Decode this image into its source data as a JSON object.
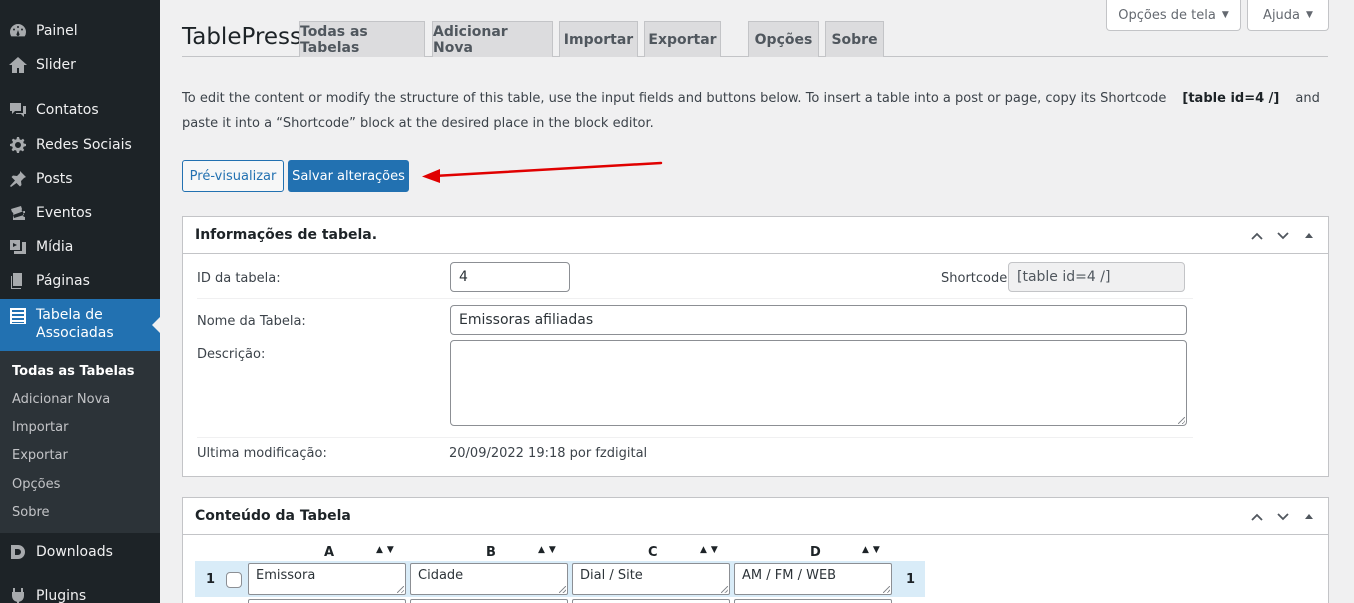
{
  "sidebar": {
    "items": [
      {
        "label": "Painel",
        "icon": "dashboard-icon"
      },
      {
        "label": "Slider",
        "icon": "home-icon"
      },
      {
        "label": "Contatos",
        "icon": "comments-icon"
      },
      {
        "label": "Redes Sociais",
        "icon": "gear-icon"
      },
      {
        "label": "Posts",
        "icon": "pin-icon"
      },
      {
        "label": "Eventos",
        "icon": "tickets-icon"
      },
      {
        "label": "Mídia",
        "icon": "media-icon"
      },
      {
        "label": "Páginas",
        "icon": "pages-icon"
      },
      {
        "label": "Tabela de Associadas",
        "icon": "list-icon"
      },
      {
        "label": "Downloads",
        "icon": "downloads-icon"
      },
      {
        "label": "Plugins",
        "icon": "plugins-icon"
      }
    ],
    "submenu": [
      "Todas as Tabelas",
      "Adicionar Nova",
      "Importar",
      "Exportar",
      "Opções",
      "Sobre"
    ],
    "accent_color": "#2271b1"
  },
  "screen_meta": {
    "options_label": "Opções de tela",
    "help_label": "Ajuda"
  },
  "header": {
    "title": "TablePress",
    "tabs": [
      "Todas as Tabelas",
      "Adicionar Nova",
      "Importar",
      "Exportar",
      "Opções",
      "Sobre"
    ]
  },
  "intro": {
    "text_before": "To edit the content or modify the structure of this table, use the input fields and buttons below. To insert a table into a post or page, copy its Shortcode",
    "shortcode": "[table id=4 /]",
    "text_after": "and paste it into a “Shortcode” block at the desired place in the block editor."
  },
  "actions": {
    "preview_label": "Pré-visualizar",
    "save_label": "Salvar alterações",
    "annotation_color": "#e00000"
  },
  "table_info": {
    "title": "Informações de tabela.",
    "id_label": "ID da tabela:",
    "id_value": "4",
    "shortcode_label": "Shortcode:",
    "shortcode_value": "[table id=4 /]",
    "name_label": "Nome da Tabela:",
    "name_value": "Emissoras afiliadas",
    "description_label": "Descrição:",
    "description_value": "",
    "modified_label": "Ultima modificação:",
    "modified_value": "20/09/2022 19:18 por fzdigital"
  },
  "table_content": {
    "title": "Conteúdo da Tabela",
    "columns": [
      "A",
      "B",
      "C",
      "D"
    ],
    "sort_arrows": "▲▼",
    "rows": [
      {
        "number": "1",
        "cells": [
          "Emissora",
          "Cidade",
          "Dial / Site",
          "AM / FM / WEB"
        ]
      }
    ]
  }
}
